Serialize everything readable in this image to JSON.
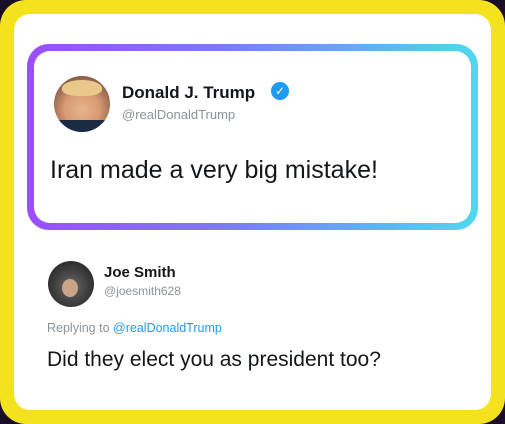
{
  "main_tweet": {
    "display_name": "Donald J. Trump",
    "handle": "@realDonaldTrump",
    "verified_icon": "verified-check-icon",
    "text": "Iran made a very big mistake!"
  },
  "reply_tweet": {
    "display_name": "Joe Smith",
    "handle": "@joesmith628",
    "replying_to_prefix": "Replying to",
    "replying_to_handle": "@realDonaldTrump",
    "text": "Did they elect you as president too?"
  },
  "colors": {
    "frame": "#f5e21e",
    "gradient_start": "#9b4dff",
    "gradient_end": "#4fd8ee",
    "link": "#1d9bf0"
  }
}
